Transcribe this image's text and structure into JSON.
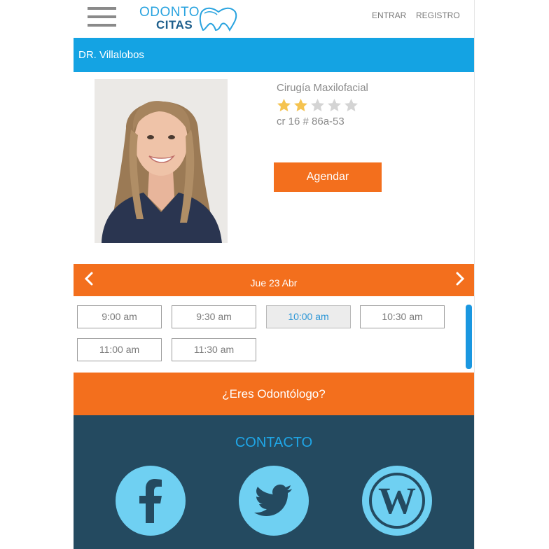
{
  "header": {
    "logo_top": "ODONTO",
    "logo_bottom": "CITAS",
    "login_label": "ENTRAR",
    "register_label": "REGISTRO"
  },
  "doctor": {
    "title": "DR. Villalobos",
    "specialty": "Cirugía Maxilofacial",
    "rating": 2,
    "rating_max": 5,
    "address": "cr 16 # 86a-53",
    "book_label": "Agendar"
  },
  "schedule": {
    "date_label": "Jue 23 Abr",
    "slots": [
      "9:00 am",
      "9:30 am",
      "10:00 am",
      "10:30 am",
      "11:00 am",
      "11:30 am"
    ],
    "selected": "10:00 am"
  },
  "dentist_banner": "¿Eres Odontólogo?",
  "footer": {
    "contact_title": "CONTACTO",
    "social": [
      "facebook-icon",
      "twitter-icon",
      "wordpress-icon"
    ]
  },
  "colors": {
    "orange": "#f36f1d",
    "blue": "#14a3e3",
    "footer_bg": "#244a60",
    "social_circle": "#6fd0f2",
    "star_on": "#f5c350",
    "star_off": "#d4d4d4"
  }
}
